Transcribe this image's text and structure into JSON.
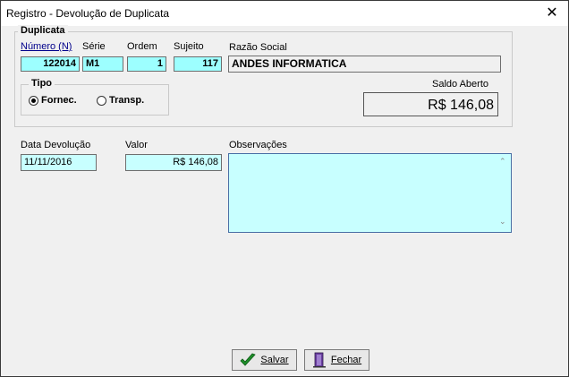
{
  "window": {
    "title": "Registro - Devolução de Duplicata"
  },
  "duplicata": {
    "legend": "Duplicata",
    "numero_label": "Número (N)",
    "numero_value": "122014",
    "serie_label": "Série",
    "serie_value": "M1",
    "ordem_label": "Ordem",
    "ordem_value": "1",
    "sujeito_label": "Sujeito",
    "sujeito_value": "117",
    "razao_label": "Razão Social",
    "razao_value": "ANDES INFORMATICA",
    "saldo_label": "Saldo Aberto",
    "saldo_value": "R$ 146,08"
  },
  "tipo": {
    "legend": "Tipo",
    "options": [
      {
        "label": "Fornec.",
        "selected": true
      },
      {
        "label": "Transp.",
        "selected": false
      }
    ]
  },
  "form": {
    "data_label": "Data Devolução",
    "data_value": "11/11/2016",
    "valor_label": "Valor",
    "valor_value": "R$ 146,08",
    "obs_label": "Observações",
    "obs_value": ""
  },
  "buttons": {
    "salvar": "Salvar",
    "fechar": "Fechar"
  },
  "colors": {
    "field_cyan": "#9dffff",
    "obs_bg": "#c8ffff",
    "link_blue": "#00008b"
  }
}
